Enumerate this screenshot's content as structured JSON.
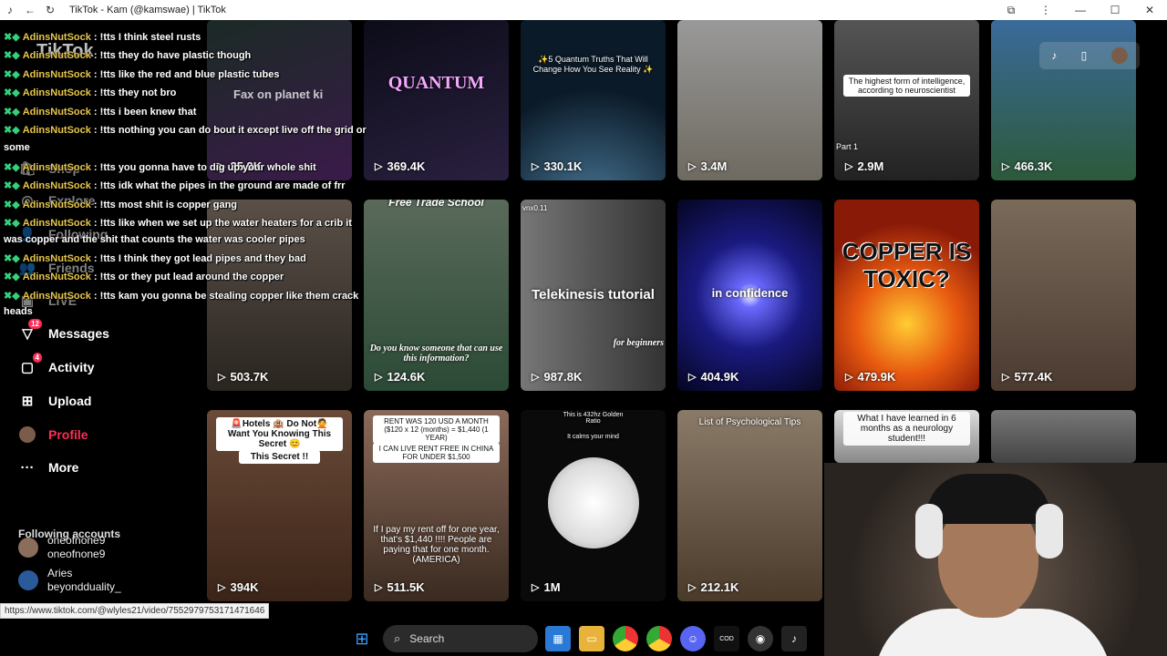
{
  "window": {
    "title": "TikTok - Kam (@kamswae) | TikTok"
  },
  "sidebar": {
    "logo": "TikTok",
    "nav": [
      {
        "label": "Fax on planet ki",
        "icon": "text"
      },
      {
        "label": "Shop",
        "icon": "shop-icon"
      },
      {
        "label": "Explore",
        "icon": "compass-icon"
      },
      {
        "label": "Following",
        "icon": "users-icon"
      },
      {
        "label": "Friends",
        "icon": "friends-icon"
      },
      {
        "label": "LIVE",
        "icon": "live-icon"
      },
      {
        "label": "Messages",
        "icon": "send-icon",
        "badge": "12"
      },
      {
        "label": "Activity",
        "icon": "inbox-icon",
        "badge": "4"
      },
      {
        "label": "Upload",
        "icon": "plus-icon"
      },
      {
        "label": "Profile",
        "icon": "avatar"
      },
      {
        "label": "More",
        "icon": "ellipsis-icon"
      }
    ],
    "following_title": "Following accounts",
    "accounts": [
      {
        "name": "oneofnone9",
        "handle": "oneofnone9"
      },
      {
        "name": "Aries",
        "handle": "beyondduality_"
      }
    ]
  },
  "chat": {
    "username": "AdinsNutSock",
    "messages": [
      "!tts I think steel rusts",
      "!tts they do have plastic though",
      "!tts like the red and blue plastic tubes",
      "!tts they not bro",
      "!tts i been knew that",
      "!tts nothing you can do bout it except live off the grid or",
      "!tts you gonna have to dig up your whole shit",
      "!tts idk what the pipes in the ground are made of frr",
      "!tts most shit is copper gang",
      "!tts like when we set up the water heaters for a crib it",
      "!tts I think they got lead pipes and they bad",
      "!tts or they put lead around the copper",
      "!tts kam you gonna be stealing copper like them crack"
    ],
    "wraps": [
      "some",
      "was copper and the shit that counts the water was cooler pipes",
      "heads"
    ]
  },
  "videos": [
    {
      "views": "25.9K",
      "caption": "",
      "color": "#1b2a25"
    },
    {
      "views": "369.4K",
      "caption": "QUANTUM",
      "color": "#0c0c18"
    },
    {
      "views": "330.1K",
      "caption": "✨5 Quantum Truths That Will Change How You See Reality ✨",
      "color": "#0b1a28"
    },
    {
      "views": "3.4M",
      "caption": "",
      "color": "#6f6a60"
    },
    {
      "views": "2.9M",
      "caption": "The highest form of intelligence, according to neuroscientist",
      "color": "#2a2a2a"
    },
    {
      "views": "466.3K",
      "caption": "",
      "color": "#2c5a3a"
    },
    {
      "views": "503.7K",
      "caption": "",
      "color": "#3a3530"
    },
    {
      "views": "124.6K",
      "caption": "Free Trade School",
      "color": "#2b4a36"
    },
    {
      "views": "987.8K",
      "caption": "Telekinesis tutorial",
      "color": "#555"
    },
    {
      "views": "404.9K",
      "caption": "in confidence",
      "color": "#1a1a80"
    },
    {
      "views": "479.9K",
      "caption": "COPPER IS TOXIC?",
      "color": "#b83a10"
    },
    {
      "views": "577.4K",
      "caption": "",
      "color": "#4b3a30"
    },
    {
      "views": "394K",
      "caption": "🚨Hotels 🏨 Do Not🙅 Want You Knowing This Secret 😊",
      "color": "#3b2418"
    },
    {
      "views": "511.5K",
      "caption": "RENT WAS 120 USD A MONTH ($120 x 12 (months) = $1,440 (1 YEAR)",
      "color": "#6a4a3a"
    },
    {
      "views": "1M",
      "caption": "This is 432hz Golden Ratio",
      "color": "#0a0a0a"
    },
    {
      "views": "212.1K",
      "caption": "List of Psychological Tips",
      "color": "#6a5a48"
    },
    {
      "views": "",
      "caption": "What I have learned in 6 months as a neurology student!!!",
      "color": "#888"
    },
    {
      "views": "",
      "caption": "",
      "color": "#555"
    }
  ],
  "extra_text": {
    "video8_sub": "Do you know someone that can use this information?",
    "video14_sub": "If I pay my rent off for one year, that's $1,440 !!!! People are paying that for one month. (AMERICA)",
    "video15_sub": "It calms your mind",
    "video13_sub": "This Secret !!",
    "video9_brand": "vnx0.11",
    "video9_sub": "for beginners",
    "video5_sub": "Part 1",
    "video14_mid": "I CAN LIVE RENT FREE IN CHINA FOR UNDER $1,500"
  },
  "status_url": "https://www.tiktok.com/@wlyles21/video/7552979753171471646",
  "taskbar": {
    "search_label": "Search"
  }
}
